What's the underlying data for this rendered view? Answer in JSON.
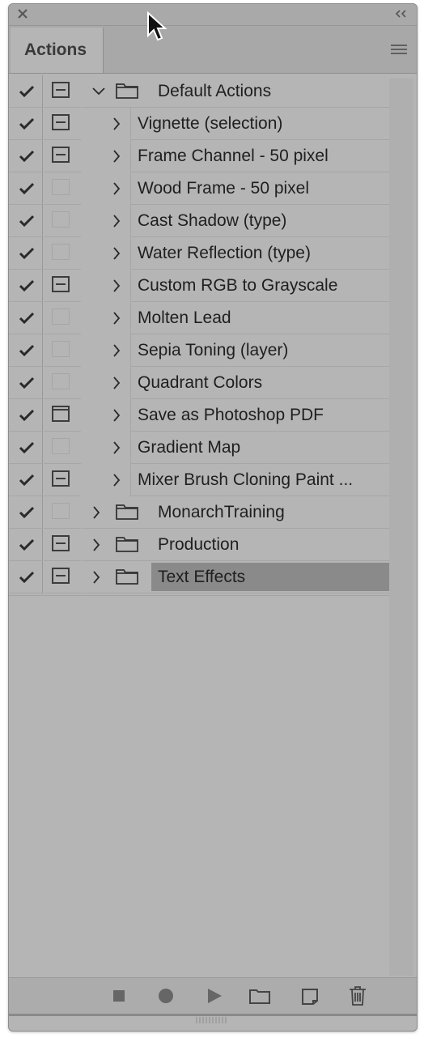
{
  "panel": {
    "tab_label": "Actions",
    "colors": {
      "panel_bg": "#b5b5b5",
      "selected_bg": "#8a8a8a",
      "text": "#1f1f1f"
    },
    "icons": {
      "close": "close-icon",
      "collapse": "collapse-double-chevron-icon",
      "menu": "panel-menu-icon"
    }
  },
  "actions": {
    "default_set": {
      "label": "Default Actions",
      "expanded": true,
      "dialog": "on"
    },
    "items": [
      {
        "label": "Vignette (selection)",
        "dialog": "on"
      },
      {
        "label": "Frame Channel - 50 pixel",
        "dialog": "on"
      },
      {
        "label": "Wood Frame - 50 pixel",
        "dialog": "off"
      },
      {
        "label": "Cast Shadow (type)",
        "dialog": "off"
      },
      {
        "label": "Water Reflection (type)",
        "dialog": "off"
      },
      {
        "label": "Custom RGB to Grayscale",
        "dialog": "on"
      },
      {
        "label": "Molten Lead",
        "dialog": "off"
      },
      {
        "label": "Sepia Toning (layer)",
        "dialog": "off"
      },
      {
        "label": "Quadrant Colors",
        "dialog": "off"
      },
      {
        "label": "Save as Photoshop PDF",
        "dialog": "full"
      },
      {
        "label": "Gradient Map",
        "dialog": "off"
      },
      {
        "label": "Mixer Brush Cloning Paint ...",
        "dialog": "on"
      }
    ],
    "other_sets": [
      {
        "label": "MonarchTraining",
        "dialog": "off",
        "selected": false
      },
      {
        "label": "Production",
        "dialog": "on",
        "selected": false
      },
      {
        "label": "Text Effects",
        "dialog": "on",
        "selected": true
      }
    ]
  },
  "toolbar": {
    "buttons": [
      "stop-recording-icon",
      "record-icon",
      "play-icon",
      "new-set-folder-icon",
      "new-action-icon",
      "trash-icon"
    ]
  }
}
